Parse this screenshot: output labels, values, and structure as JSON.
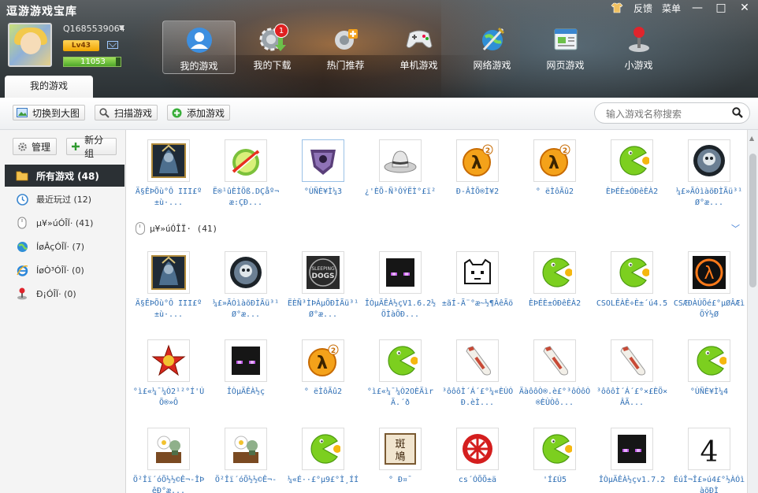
{
  "app": {
    "title": "逗游游戏宝库"
  },
  "system": {
    "skin_icon": "shirt-icon",
    "feedback": "反馈",
    "menu": "菜单",
    "min": "—",
    "max": "□",
    "close": "✕"
  },
  "user": {
    "id": "Q1685539064",
    "level": "Lv43",
    "xp": "11053",
    "xp_fraction": 0.92
  },
  "nav": [
    {
      "name": "nav-my-games",
      "label": "我的游戏",
      "icon": "user-group-icon"
    },
    {
      "name": "nav-my-downloads",
      "label": "我的下载",
      "icon": "download-gear-icon",
      "badge": "1"
    },
    {
      "name": "nav-hot",
      "label": "热门推荐",
      "icon": "hot-plus-icon"
    },
    {
      "name": "nav-single",
      "label": "单机游戏",
      "icon": "gamepad-icon"
    },
    {
      "name": "nav-online",
      "label": "网络游戏",
      "icon": "globe-sword-icon"
    },
    {
      "name": "nav-web",
      "label": "网页游戏",
      "icon": "webpage-icon"
    },
    {
      "name": "nav-mini",
      "label": "小游戏",
      "icon": "joystick-icon"
    }
  ],
  "tab": {
    "label": "我的游戏"
  },
  "toolbar": {
    "big_view": "切换到大图",
    "scan": "扫描游戏",
    "add": "添加游戏"
  },
  "search": {
    "placeholder": "输入游戏名称搜索"
  },
  "sidebar": {
    "manage": "管理",
    "new_group": "新分组",
    "categories": [
      {
        "label": "所有游戏 (48)",
        "icon": "folder-icon",
        "active": true
      },
      {
        "label": "最近玩过 (12)",
        "icon": "clock-icon"
      },
      {
        "label": "µ¥»úÓÎÏ· (41)",
        "icon": "mouse-icon"
      },
      {
        "label": "ÍøÂçÓÎÏ· (7)",
        "icon": "globe-icon"
      },
      {
        "label": "ÍøÒ³ÓÎÏ· (0)",
        "icon": "ie-icon"
      },
      {
        "label": "Ð¡ÓÎÏ· (0)",
        "icon": "joystick-icon"
      }
    ]
  },
  "group_header": {
    "label": "µ¥»úÓÎÏ· (41)"
  },
  "recent_games": [
    {
      "icon": "warcraft-icon",
      "name": "Ä§ÊÞÕù°Ô III£º±ù·..."
    },
    {
      "icon": "fruit-ninja-icon",
      "name": "Ë®¹ûÈÌÕß.DÇåº¬æ:ÇÐ..."
    },
    {
      "icon": "saints-row-icon",
      "name": "°ÙÑÈ¥Ì¼3",
      "selected": true
    },
    {
      "icon": "hat-icon",
      "name": "¿'ÈÕ-Ñ³ÔÝËÌ°£ï²"
    },
    {
      "icon": "half-life2-icon",
      "name": "Ð-ÂÌÕ®Ì¥2"
    },
    {
      "icon": "half-life2-icon",
      "name": "° ëÌôÃû2"
    },
    {
      "icon": "pacman-icon",
      "name": "ÈÞÉÈ±ÓÐêÈÀ2"
    },
    {
      "icon": "skull-icon",
      "name": "¼£»ÃÓìàõÐÌÃü³¹Ø°æ..."
    }
  ],
  "group_games": [
    {
      "icon": "warcraft-icon",
      "name": "Ä§ÊÞÕù°Ô III£º±ù·..."
    },
    {
      "icon": "skull-icon",
      "name": "¼£»ÃÓìàõÐÌÃü³¹Ø°æ..."
    },
    {
      "icon": "sleeping-dogs-icon",
      "name": "ËÈÑ³ÌÞÁµÕÐÌÃü³¹Ø°æ..."
    },
    {
      "icon": "enderman-icon",
      "name": "ÎÒµÄÊÀ½çV1.6.2½ÖÌàÕÐ..."
    },
    {
      "icon": "pixel-cat-icon",
      "name": "±ãÍ-Ã¨°æ~½¶ÂêÃö"
    },
    {
      "icon": "pacman-icon",
      "name": "ÈÞÉÈ±ÓÐêÈÀ2"
    },
    {
      "icon": "pacman-icon",
      "name": "CSOLÊÀÊ÷È±´ú4.5"
    },
    {
      "icon": "half-life-icon",
      "name": "CSÆÐÀÚÕé£°µØÂÆìÕÝ½Ø"
    },
    {
      "icon": "red-alert-icon",
      "name": "°ì£«¼¯¼Ò2¹²°Í'ÚÕ®»Ô"
    },
    {
      "icon": "enderman-icon",
      "name": "ÎÒµÄÊÀ½ç"
    },
    {
      "icon": "half-life2-icon",
      "name": "° ëÌôÃû2"
    },
    {
      "icon": "pacman-icon",
      "name": "°ì£«¼¯¼Ò2OÈÄìrÃ.´ð"
    },
    {
      "icon": "bottle-icon",
      "name": "³ôôôÌ´Á´£°¼«ÈÙÒÐ.èÌ..."
    },
    {
      "icon": "bottle-icon",
      "name": "ÄàôôÒ®.è£°³ôÒôÒ®ÈÙÒô..."
    },
    {
      "icon": "bottle-icon",
      "name": "³ôôôÌ´Á´£°×£ÈÖ×ÂÃ..."
    },
    {
      "icon": "pacman-icon",
      "name": "°ÙÑÈ¥Ì¼4"
    },
    {
      "icon": "pvz-icon",
      "name": "Ö²Îï´óÕ½½©Ê¬-ÎÞêÐ°æ..."
    },
    {
      "icon": "pvz-icon",
      "name": "Ö²Îï´óÕ½½©Ê¬-"
    },
    {
      "icon": "pacman-icon",
      "name": "¼«É··£°µ9£°Ì¸ÍÍ"
    },
    {
      "icon": "kanji-icon",
      "name": "° Ð¤¯"
    },
    {
      "icon": "umbrella-icon",
      "name": "cs´ÓÕÕ±ä"
    },
    {
      "icon": "pacman-icon",
      "name": "'Í£Ú5"
    },
    {
      "icon": "enderman-icon",
      "name": "ÎÒµÄÊÀ½çv1.7.2"
    },
    {
      "icon": "resident-evil4-icon",
      "name": "ÉúÎ¬Î£»ú4£°½ÀÓìàõÐÌ"
    }
  ]
}
